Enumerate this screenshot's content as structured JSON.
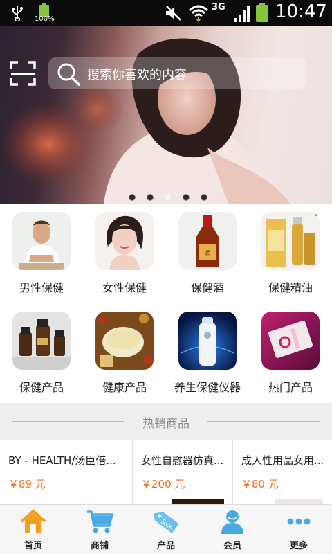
{
  "status_bar": {
    "battery_small_pct": "100%",
    "network": "3G",
    "time": "10:47",
    "icons": [
      "usb-icon",
      "battery-icon",
      "mute-icon",
      "wifi-icon",
      "signal-icon"
    ]
  },
  "banner": {
    "search_placeholder": "搜索你喜欢的内容",
    "slide_count": 5,
    "active_slide": 3
  },
  "categories": [
    {
      "label": "男性保健",
      "icon": "male-health-image"
    },
    {
      "label": "女性保健",
      "icon": "female-health-image"
    },
    {
      "label": "保健酒",
      "icon": "health-wine-image"
    },
    {
      "label": "保健精油",
      "icon": "essential-oil-image"
    },
    {
      "label": "保健产品",
      "icon": "health-products-image"
    },
    {
      "label": "健康产品",
      "icon": "wellness-products-image"
    },
    {
      "label": "养生保健仪器",
      "icon": "health-instrument-image"
    },
    {
      "label": "热门产品",
      "icon": "hot-products-image"
    }
  ],
  "hot_section": {
    "title": "热销商品"
  },
  "products": [
    {
      "name": "BY - HEALTH/汤臣倍...",
      "price": "￥89 元"
    },
    {
      "name": "女性自慰器仿真...",
      "price": "￥200 元"
    },
    {
      "name": "成人性用品女用...",
      "price": "￥80 元"
    }
  ],
  "bottom_nav": [
    {
      "label": "首页",
      "icon": "home-icon"
    },
    {
      "label": "商铺",
      "icon": "cart-icon"
    },
    {
      "label": "产品",
      "icon": "sale-tag-icon"
    },
    {
      "label": "会员",
      "icon": "member-icon"
    },
    {
      "label": "更多",
      "icon": "more-icon"
    }
  ],
  "colors": {
    "price": "#f26a1b",
    "nav_accent": "#4aa8e0",
    "battery": "#86c440",
    "home_icon": "#f0a020"
  }
}
